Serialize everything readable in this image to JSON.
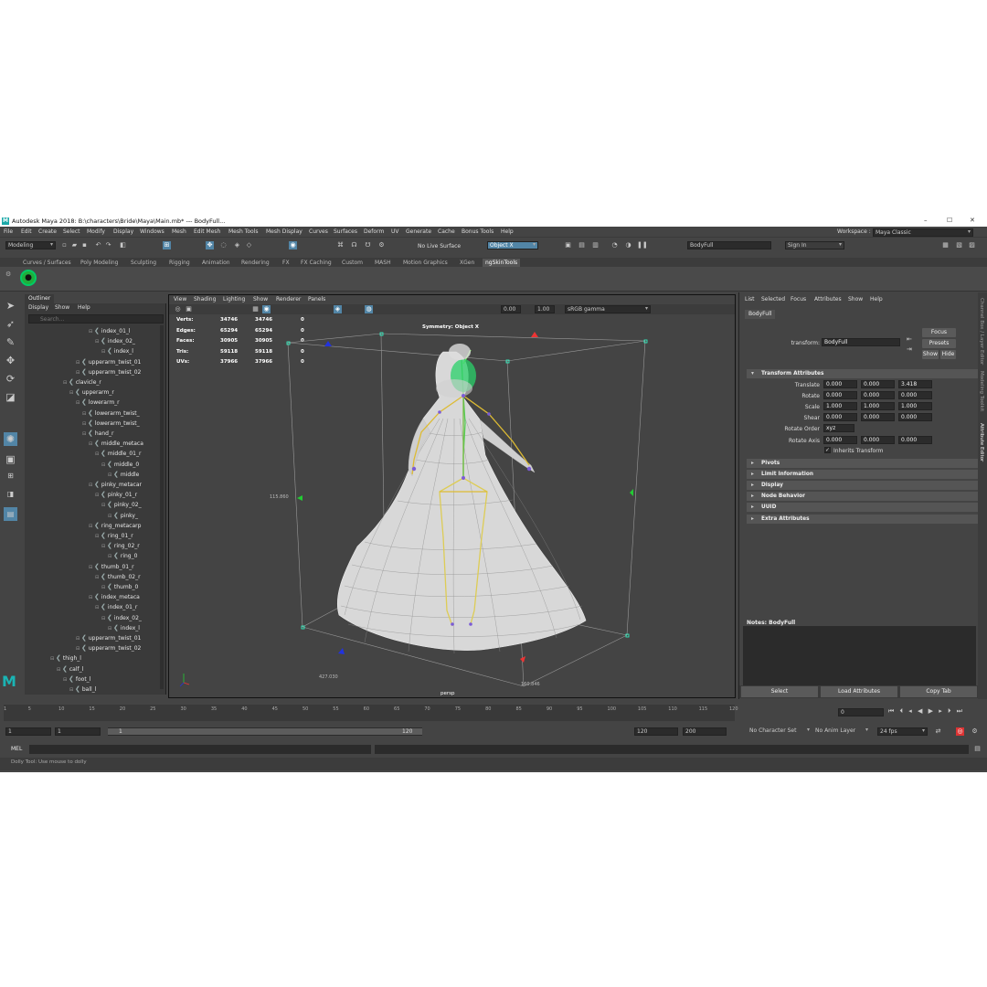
{
  "window": {
    "app_logo": "M",
    "title": "Autodesk Maya 2018: B:\\characters\\Bride\\Maya\\Main.mb*   ---   BodyFull...",
    "controls": [
      "–",
      "☐",
      "✕"
    ]
  },
  "menubar": {
    "items": [
      "File",
      "Edit",
      "Create",
      "Select",
      "Modify",
      "Display",
      "Windows",
      "Mesh",
      "Edit Mesh",
      "Mesh Tools",
      "Mesh Display",
      "Curves",
      "Surfaces",
      "Deform",
      "UV",
      "Generate",
      "Cache",
      "Bonus Tools",
      "Help"
    ],
    "workspace_label": "Workspace :",
    "workspace_value": "Maya Classic"
  },
  "statusline": {
    "menuset": "Modeling",
    "live_surface": "No Live Surface",
    "symmetry": "Object X",
    "name_field": "BodyFull",
    "sign_in": "Sign In"
  },
  "shelf": {
    "tabs": [
      "Curves / Surfaces",
      "Poly Modeling",
      "Sculpting",
      "Rigging",
      "Animation",
      "Rendering",
      "FX",
      "FX Caching",
      "Custom",
      "MASH",
      "Motion Graphics",
      "XGen",
      "ngSkinTools"
    ],
    "selected_tab": "ngSkinTools"
  },
  "outliner": {
    "title": "Outliner",
    "menus": [
      "Display",
      "Show",
      "Help"
    ],
    "search_placeholder": "Search...",
    "items": [
      {
        "label": "index_01_l",
        "depth": 8
      },
      {
        "label": "index_02_",
        "depth": 9
      },
      {
        "label": "index_l",
        "depth": 10
      },
      {
        "label": "upperarm_twist_01",
        "depth": 6
      },
      {
        "label": "upperarm_twist_02",
        "depth": 6
      },
      {
        "label": "clavicle_r",
        "depth": 4
      },
      {
        "label": "upperarm_r",
        "depth": 5
      },
      {
        "label": "lowerarm_r",
        "depth": 6
      },
      {
        "label": "lowerarm_twist_",
        "depth": 7
      },
      {
        "label": "lowerarm_twist_",
        "depth": 7
      },
      {
        "label": "hand_r",
        "depth": 7
      },
      {
        "label": "middle_metaca",
        "depth": 8
      },
      {
        "label": "middle_01_r",
        "depth": 9
      },
      {
        "label": "middle_0",
        "depth": 10
      },
      {
        "label": "middle",
        "depth": 11
      },
      {
        "label": "pinky_metacar",
        "depth": 8
      },
      {
        "label": "pinky_01_r",
        "depth": 9
      },
      {
        "label": "pinky_02_",
        "depth": 10
      },
      {
        "label": "pinky_",
        "depth": 11
      },
      {
        "label": "ring_metacarp",
        "depth": 8
      },
      {
        "label": "ring_01_r",
        "depth": 9
      },
      {
        "label": "ring_02_r",
        "depth": 10
      },
      {
        "label": "ring_0",
        "depth": 11
      },
      {
        "label": "thumb_01_r",
        "depth": 8
      },
      {
        "label": "thumb_02_r",
        "depth": 9
      },
      {
        "label": "thumb_0",
        "depth": 10
      },
      {
        "label": "index_metaca",
        "depth": 8
      },
      {
        "label": "index_01_r",
        "depth": 9
      },
      {
        "label": "index_02_",
        "depth": 10
      },
      {
        "label": "index_l",
        "depth": 11
      },
      {
        "label": "upperarm_twist_01",
        "depth": 6
      },
      {
        "label": "upperarm_twist_02",
        "depth": 6
      },
      {
        "label": "thigh_l",
        "depth": 2
      },
      {
        "label": "calf_l",
        "depth": 3
      },
      {
        "label": "foot_l",
        "depth": 4
      },
      {
        "label": "ball_l",
        "depth": 5
      }
    ]
  },
  "viewport": {
    "menus": [
      "View",
      "Shading",
      "Lighting",
      "Show",
      "Renderer",
      "Panels"
    ],
    "exposure": "0.00",
    "gamma": "1.00",
    "color_space": "sRGB gamma",
    "symmetry_label": "Symmetry: Object X",
    "camera": "persp",
    "stats": [
      {
        "label": "Verts:",
        "a": "34746",
        "b": "34746",
        "c": "0"
      },
      {
        "label": "Edges:",
        "a": "65294",
        "b": "65294",
        "c": "0"
      },
      {
        "label": "Faces:",
        "a": "30905",
        "b": "30905",
        "c": "0"
      },
      {
        "label": "Tris:",
        "a": "59118",
        "b": "59118",
        "c": "0"
      },
      {
        "label": "UVs:",
        "a": "37966",
        "b": "37966",
        "c": "0"
      }
    ],
    "dim_labels": [
      "115.860",
      "427.030",
      "160.846"
    ]
  },
  "attribute_editor": {
    "menus": [
      "List",
      "Selected",
      "Focus",
      "Attributes",
      "Show",
      "Help"
    ],
    "node_tab": "BodyFull",
    "transform_label": "transform:",
    "transform_value": "BodyFull",
    "focus_btn": "Focus",
    "presets_btn": "Presets",
    "show_btn": "Show",
    "hide_btn": "Hide",
    "section_transform": "Transform Attributes",
    "translate_label": "Translate",
    "translate": [
      "0.000",
      "0.000",
      "3.418"
    ],
    "rotate_label": "Rotate",
    "rotate": [
      "0.000",
      "0.000",
      "0.000"
    ],
    "scale_label": "Scale",
    "scale": [
      "1.000",
      "1.000",
      "1.000"
    ],
    "shear_label": "Shear",
    "shear": [
      "0.000",
      "0.000",
      "0.000"
    ],
    "rotate_order_label": "Rotate Order",
    "rotate_order": "xyz",
    "rotate_axis_label": "Rotate Axis",
    "rotate_axis": [
      "0.000",
      "0.000",
      "0.000"
    ],
    "inherits_label": "Inherits Transform",
    "sections": [
      "Pivots",
      "Limit Information",
      "Display",
      "Node Behavior",
      "UUID",
      "Extra Attributes"
    ],
    "notes_label": "Notes: BodyFull",
    "bottom_buttons": [
      "Select",
      "Load Attributes",
      "Copy Tab"
    ]
  },
  "side_tabs": [
    "Channel Box / Layer Editor",
    "Modeling Toolkit",
    "Attribute Editor"
  ],
  "timeslider": {
    "ticks": [
      "1",
      "5",
      "10",
      "15",
      "20",
      "25",
      "30",
      "35",
      "40",
      "45",
      "50",
      "55",
      "60",
      "65",
      "70",
      "75",
      "80",
      "85",
      "90",
      "95",
      "100",
      "105",
      "110",
      "115",
      "120"
    ],
    "current_frame": "0"
  },
  "range": {
    "start": "1",
    "inner_start": "1",
    "slider_start": "1",
    "slider_end": "120",
    "end": "120",
    "outer_end": "200",
    "character_set": "No Character Set",
    "anim_layer": "No Anim Layer",
    "fps": "24 fps",
    "range_progress": 1.0
  },
  "command": {
    "label": "MEL"
  },
  "help": {
    "text": "Dolly Tool: Use mouse to dolly"
  }
}
